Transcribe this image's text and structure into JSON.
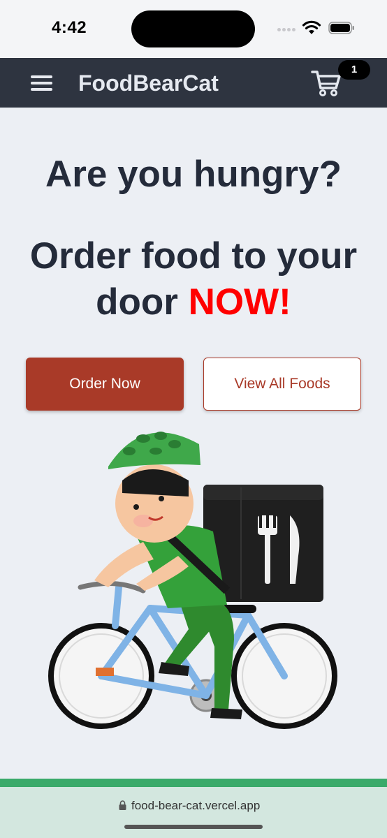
{
  "status_bar": {
    "time": "4:42"
  },
  "navbar": {
    "brand": "FoodBearCat",
    "menu_icon": "hamburger-menu-icon",
    "cart_icon": "shopping-cart-icon",
    "cart_count": "1",
    "background_color": "#2e3440"
  },
  "hero": {
    "headline": "Are you hungry?",
    "subheadline_part1": "Order food to your door",
    "subheadline_highlight": "NOW!",
    "highlight_color": "#ff0000",
    "illustration": "delivery-cyclist-illustration"
  },
  "actions": {
    "order_now_label": "Order Now",
    "view_all_label": "View All Foods",
    "accent_color": "#a93a28"
  },
  "browser": {
    "url": "food-bear-cat.vercel.app"
  }
}
